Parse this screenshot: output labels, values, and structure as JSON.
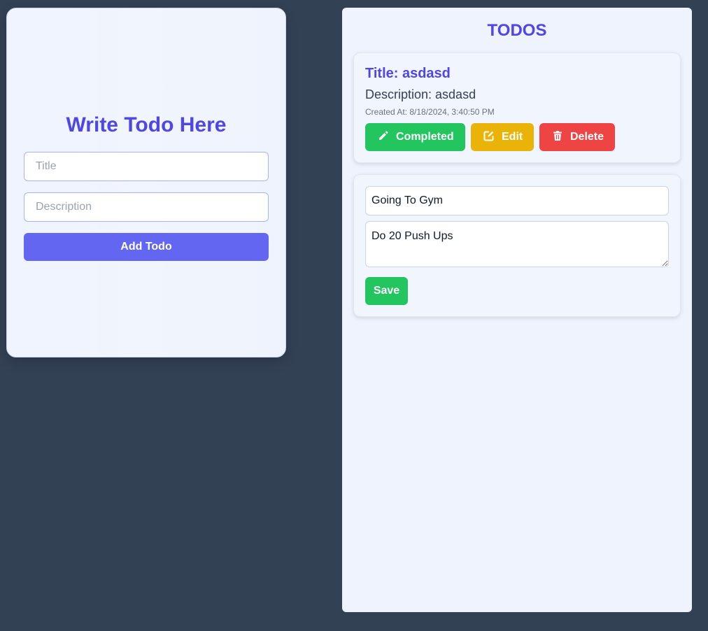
{
  "write_card": {
    "heading": "Write Todo Here",
    "title_placeholder": "Title",
    "description_placeholder": "Description",
    "add_button_label": "Add Todo"
  },
  "todos_panel": {
    "heading": "TODOS",
    "todo": {
      "title_text": "Title: asdasd",
      "description_text": "Description: asdasd",
      "created_text": "Created At: 8/18/2024, 3:40:50 PM",
      "buttons": {
        "completed": {
          "label": "Completed",
          "icon": "pencil-icon"
        },
        "edit": {
          "label": "Edit",
          "icon": "edit-square-icon"
        },
        "delete": {
          "label": "Delete",
          "icon": "trash-icon"
        }
      }
    },
    "edit_form": {
      "title_value": "Going To Gym",
      "description_value": "Do 20 Push Ups",
      "save_label": "Save"
    }
  },
  "colors": {
    "background": "#334155",
    "accent": "#4f46e5",
    "primary_button": "#6366f1",
    "success": "#22c55e",
    "warning": "#eab308",
    "danger": "#ef4444"
  }
}
